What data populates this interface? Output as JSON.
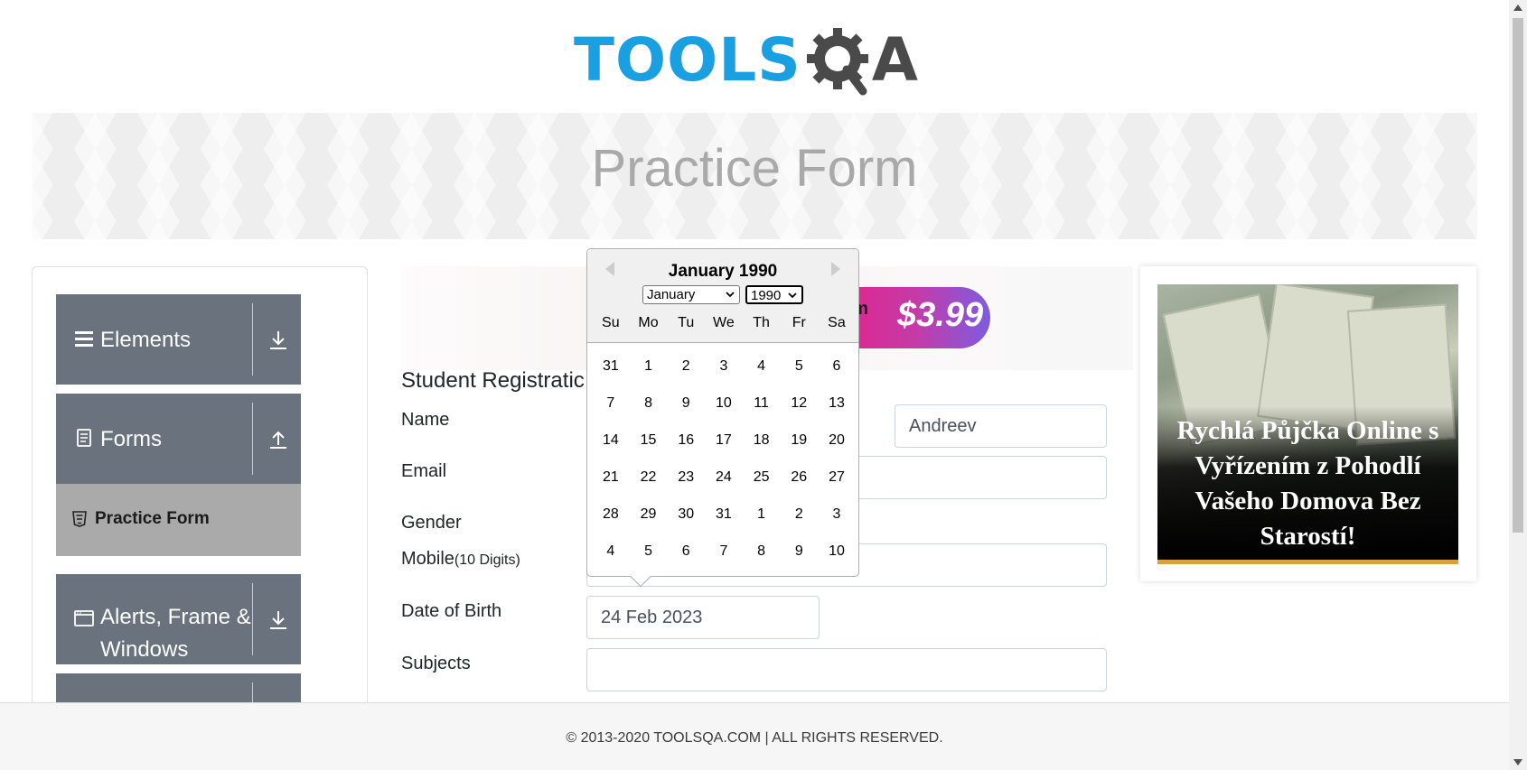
{
  "header": {
    "logo_tools": "TOOLS",
    "logo_a": "A",
    "brand_color": "#1aa0e0",
    "logo_dark": "#4a4a4a"
  },
  "banner": {
    "title": "Practice Form"
  },
  "sidebar": {
    "groups": [
      {
        "label": "Elements",
        "icon": "hamburger-icon",
        "arrow": "download-icon"
      },
      {
        "label": "Forms",
        "icon": "document-icon",
        "arrow": "upload-icon"
      },
      {
        "label": "Alerts, Frame &",
        "label2": "Windows",
        "icon": "window-icon",
        "arrow": "download-icon"
      }
    ],
    "active_item": {
      "label": "Practice Form",
      "icon": "html5-icon"
    },
    "group_color": "#69727d",
    "active_color": "#aaaaaa"
  },
  "ad_strip": {
    "price_prefix": "am",
    "price": "$3.99"
  },
  "form": {
    "title": "Student Registratic",
    "labels": {
      "name": "Name",
      "email": "Email",
      "gender": "Gender",
      "mobile": "Mobile",
      "mobile_hint": "(10 Digits)",
      "dob": "Date of Birth",
      "subjects": "Subjects"
    },
    "last_name_value": "Andreev",
    "dob_value": "24 Feb 2023",
    "subjects_value": ""
  },
  "datepicker": {
    "current_month": "January 1990",
    "month_select": "January",
    "year_select": "1990",
    "day_names": [
      "Su",
      "Mo",
      "Tu",
      "We",
      "Th",
      "Fr",
      "Sa"
    ],
    "weeks": [
      [
        "31",
        "1",
        "2",
        "3",
        "4",
        "5",
        "6"
      ],
      [
        "7",
        "8",
        "9",
        "10",
        "11",
        "12",
        "13"
      ],
      [
        "14",
        "15",
        "16",
        "17",
        "18",
        "19",
        "20"
      ],
      [
        "21",
        "22",
        "23",
        "24",
        "25",
        "26",
        "27"
      ],
      [
        "28",
        "29",
        "30",
        "31",
        "1",
        "2",
        "3"
      ],
      [
        "4",
        "5",
        "6",
        "7",
        "8",
        "9",
        "10"
      ]
    ]
  },
  "right_ad": {
    "text": "Rychlá Půjčka Online s Vyřízením z Pohodlí Vašeho Domova Bez Starostí!",
    "accent": "#d4a33b"
  },
  "footer": {
    "text": "© 2013-2020 TOOLSQA.COM | ALL RIGHTS RESERVED."
  }
}
